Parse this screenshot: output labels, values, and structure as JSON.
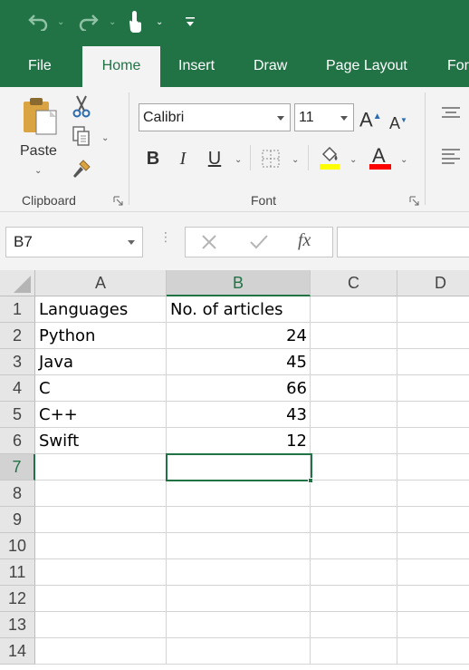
{
  "qat": {
    "undo_icon": "undo-icon",
    "redo_icon": "redo-icon",
    "touch_icon": "touch-mode-icon",
    "customize_icon": "customize-qat-icon"
  },
  "tabs": [
    {
      "label": "File"
    },
    {
      "label": "Home"
    },
    {
      "label": "Insert"
    },
    {
      "label": "Draw"
    },
    {
      "label": "Page Layout"
    },
    {
      "label": "For"
    }
  ],
  "ribbon": {
    "clipboard": {
      "label": "Clipboard",
      "paste_label": "Paste"
    },
    "font": {
      "label": "Font",
      "font_name": "Calibri",
      "font_size": "11",
      "bold": "B",
      "italic": "I",
      "underline": "U",
      "grow": "A",
      "shrink": "A",
      "font_color": "A"
    },
    "colors": {
      "accent": "#217346",
      "highlight": "#ffff00",
      "font_color": "#ff0000"
    }
  },
  "formula_bar": {
    "name_box": "B7",
    "fx": "fx",
    "formula": ""
  },
  "sheet": {
    "columns": [
      "A",
      "B",
      "C",
      "D"
    ],
    "rows": [
      "1",
      "2",
      "3",
      "4",
      "5",
      "6",
      "7",
      "8",
      "9",
      "10",
      "11",
      "12",
      "13",
      "14"
    ],
    "cells": {
      "A1": "Languages",
      "B1": "No. of articles",
      "A2": "Python",
      "B2": "24",
      "A3": "Java",
      "B3": "45",
      "A4": "C",
      "B4": "66",
      "A5": "C++",
      "B5": "43",
      "A6": "Swift",
      "B6": "12"
    },
    "active_cell": "B7"
  }
}
